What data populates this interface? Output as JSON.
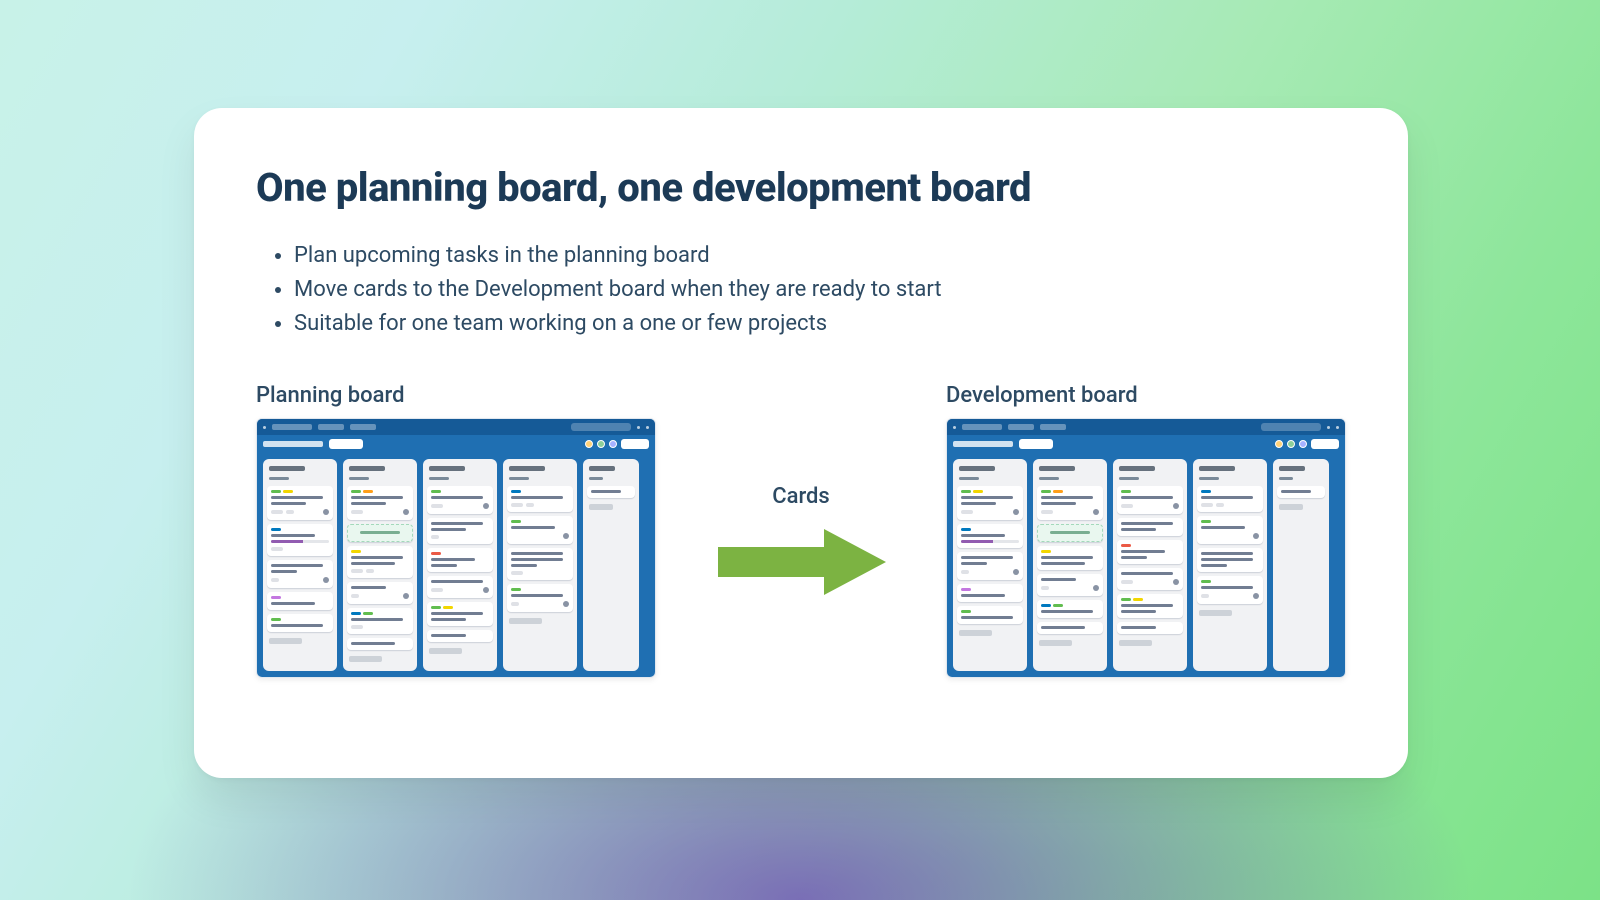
{
  "slide": {
    "title": "One planning board, one development board",
    "bullets": [
      "Plan upcoming tasks in the planning board",
      "Move cards to the Development board when they are ready to start",
      "Suitable for one team working on a one or few projects"
    ],
    "left_label": "Planning board",
    "right_label": "Development board",
    "arrow_label": "Cards"
  },
  "colors": {
    "text_heading": "#1c3a56",
    "text_body": "#2d4a63",
    "arrow": "#7cb342",
    "board_bg": "#1f6fb2"
  }
}
